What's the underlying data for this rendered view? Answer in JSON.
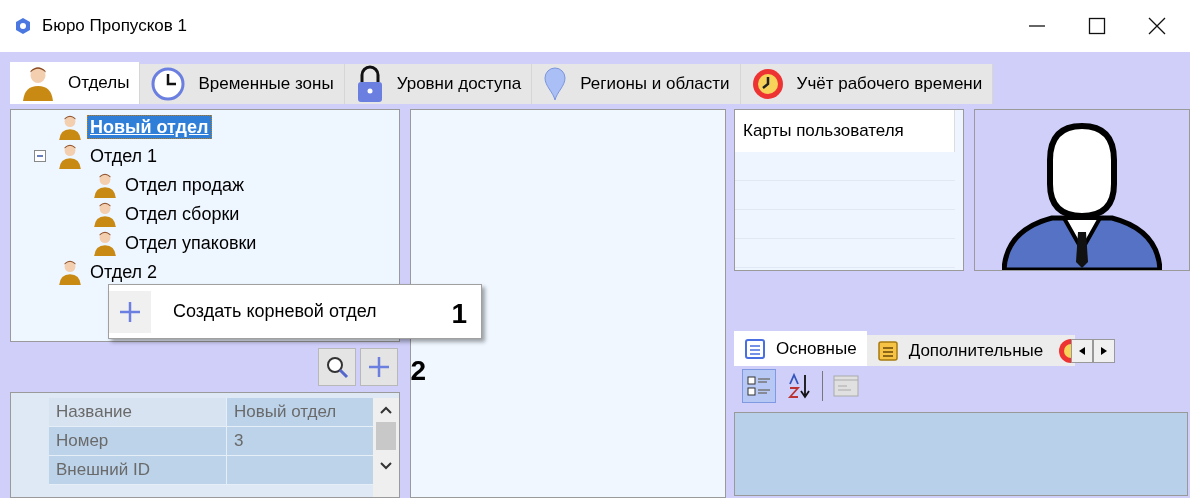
{
  "window": {
    "title": "Бюро Пропусков 1"
  },
  "tabs": [
    {
      "label": "Отделы",
      "selected": true,
      "kind": "person"
    },
    {
      "label": "Временные зоны",
      "selected": false,
      "kind": "clock"
    },
    {
      "label": "Уровни доступа",
      "selected": false,
      "kind": "lock"
    },
    {
      "label": "Регионы и области",
      "selected": false,
      "kind": "pin"
    },
    {
      "label": "Учёт рабочего времени",
      "selected": false,
      "kind": "alarm"
    }
  ],
  "tree": [
    {
      "label": "Новый отдел",
      "selected": true
    },
    {
      "label": "Отдел 1",
      "selected": false,
      "expanded": true,
      "children": [
        {
          "label": "Отдел продаж",
          "selected": false
        },
        {
          "label": "Отдел сборки",
          "selected": false
        },
        {
          "label": "Отдел упаковки",
          "selected": false
        }
      ]
    },
    {
      "label": "Отдел 2",
      "selected": false
    }
  ],
  "context_menu": {
    "items": [
      {
        "label": "Создать корневой отдел"
      }
    ],
    "callout": "1"
  },
  "tree_toolbar": {
    "callout": "2"
  },
  "properties": [
    {
      "name": "Название",
      "value": "Новый отдел"
    },
    {
      "name": "Номер",
      "value": "3"
    },
    {
      "name": "Внешний ID"
    }
  ],
  "cards": {
    "header": "Карты пользователя"
  },
  "detail_tabs": [
    {
      "label": "Основные",
      "selected": true,
      "kind": "list-blue"
    },
    {
      "label": "Дополнительные",
      "selected": false,
      "kind": "list-yellow"
    },
    {
      "selected": false,
      "kind": "alarm"
    }
  ],
  "detail_toolbar": {
    "categorized": true
  }
}
